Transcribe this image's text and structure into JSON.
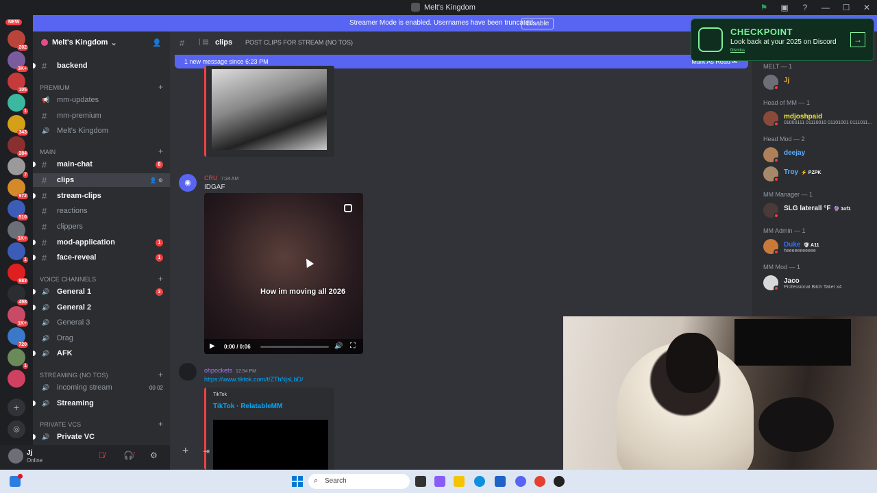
{
  "window": {
    "title": "Melt's Kingdom"
  },
  "banner": {
    "text": "Streamer Mode is enabled. Usernames have been truncated.",
    "button": "Disable"
  },
  "servers": {
    "new_label": "NEW",
    "items": [
      {
        "badge": "202",
        "color": "#b8443a"
      },
      {
        "badge": "3K+",
        "color": "#7a5c9e"
      },
      {
        "badge": "105",
        "color": "#c53a3a"
      },
      {
        "badge": "1",
        "color": "#3bb8a0"
      },
      {
        "badge": "343",
        "color": "#d4a017"
      },
      {
        "badge": "284",
        "color": "#8a2f2f"
      },
      {
        "badge": "7",
        "color": "#9a9a9a"
      },
      {
        "badge": "972",
        "color": "#d58a2a"
      },
      {
        "badge": "510",
        "color": "#3b5db8"
      },
      {
        "badge": "1K+",
        "color": "#6d6f78"
      },
      {
        "badge": "1",
        "color": "#3b5db8"
      },
      {
        "badge": "983",
        "color": "#e02020"
      },
      {
        "badge": "498",
        "color": "#2b2d31"
      },
      {
        "badge": "1K+",
        "color": "#c84a64"
      },
      {
        "badge": "720",
        "color": "#3a78c8"
      },
      {
        "badge": "1",
        "color": "#6b8a5a"
      },
      {
        "badge": "",
        "color": "#d04060"
      }
    ],
    "add_icon": "+",
    "discover_icon": "compass-icon"
  },
  "guild": {
    "name": "Melt's Kingdom"
  },
  "channels": [
    {
      "name": "backend",
      "kind": "text",
      "unread": true
    },
    {
      "category": "PREMIUM"
    },
    {
      "name": "mm-updates",
      "kind": "announce"
    },
    {
      "name": "mm-premium",
      "kind": "text"
    },
    {
      "name": "Melt's Kingdom",
      "kind": "voice"
    },
    {
      "category": "MAIN"
    },
    {
      "name": "main-chat",
      "kind": "text",
      "unread": true,
      "badge": "8"
    },
    {
      "name": "clips",
      "kind": "text",
      "active": true
    },
    {
      "name": "stream-clips",
      "kind": "text",
      "unread": true
    },
    {
      "name": "reactions",
      "kind": "text"
    },
    {
      "name": "clippers",
      "kind": "text"
    },
    {
      "name": "mod-application",
      "kind": "text",
      "unread": true,
      "badge": "1"
    },
    {
      "name": "face-reveal",
      "kind": "text",
      "unread": true,
      "badge": "1"
    },
    {
      "category": "VOICE CHANNELS"
    },
    {
      "name": "General 1",
      "kind": "voice",
      "unread": true,
      "badge": "3"
    },
    {
      "name": "General 2",
      "kind": "voice",
      "unread": true
    },
    {
      "name": "General 3",
      "kind": "voice"
    },
    {
      "name": "Drag",
      "kind": "voice"
    },
    {
      "name": "AFK",
      "kind": "voice",
      "unread": true
    },
    {
      "category": "STREAMING (NO TOS)"
    },
    {
      "name": "incoming stream",
      "kind": "voice",
      "extra": "00 02"
    },
    {
      "name": "Streaming",
      "kind": "voice",
      "unread": true
    },
    {
      "category": "PRIVATE VCS"
    },
    {
      "name": "Private VC",
      "kind": "voice",
      "unread": true
    }
  ],
  "user": {
    "name": "Jj",
    "status": "Online"
  },
  "chat": {
    "channel": "clips",
    "topic": "POST CLIPS FOR STREAM (NO TOS)",
    "new_messages": "1 new message since 6:23 PM",
    "mark_read": "Mark As Read",
    "messages": [
      {
        "author": "CRU",
        "author_color": "#f23f43",
        "time": "7:34 AM",
        "text": "IDGAF",
        "video": {
          "caption": "How im moving all 2026",
          "time": "0:00 / 0:06"
        }
      },
      {
        "author": "ohpockets",
        "author_color": "#a47bf2",
        "time": "12:54 PM",
        "link": "https://www.tiktok.com/t/ZThNjsLbD/",
        "embed": {
          "provider": "TikTok",
          "title": "TikTok · RelatableMM"
        }
      }
    ]
  },
  "checkpoint": {
    "title": "CHECKPOINT",
    "subtitle": "Look back at your 2025 on Discord",
    "dismiss": "Dismiss"
  },
  "members": {
    "groups": [
      {
        "title": "MELT — 1",
        "members": [
          {
            "name": "Jj",
            "color": "#f0b232",
            "sub": ""
          }
        ]
      },
      {
        "title": "Head of MM — 1",
        "members": [
          {
            "name": "mdjoshpaid",
            "color": "#f0e442",
            "sub": "01000111 01110010 01101001 0111011..."
          }
        ]
      },
      {
        "title": "Head Mod — 2",
        "members": [
          {
            "name": "deejay",
            "color": "#5ab0ff",
            "sub": ""
          },
          {
            "name": "Troy",
            "color": "#5ab0ff",
            "sub": "",
            "tag": "⚡ PZPK"
          }
        ]
      },
      {
        "title": "MM Manager — 1",
        "members": [
          {
            "name": "SLG laterall °F",
            "color": "#f2f3f5",
            "sub": "",
            "tag": "🔮 1of1"
          }
        ]
      },
      {
        "title": "MM Admin — 1",
        "members": [
          {
            "name": "Duke",
            "color": "#3b6cf2",
            "sub": "heeeeeeeeeee",
            "tag": "🛡 A11"
          }
        ]
      },
      {
        "title": "MM Mod — 1",
        "members": [
          {
            "name": "Jaco",
            "color": "#f2f3f5",
            "sub": "Professional Bitch Taker x4"
          }
        ]
      }
    ]
  },
  "taskbar": {
    "search_placeholder": "Search"
  }
}
